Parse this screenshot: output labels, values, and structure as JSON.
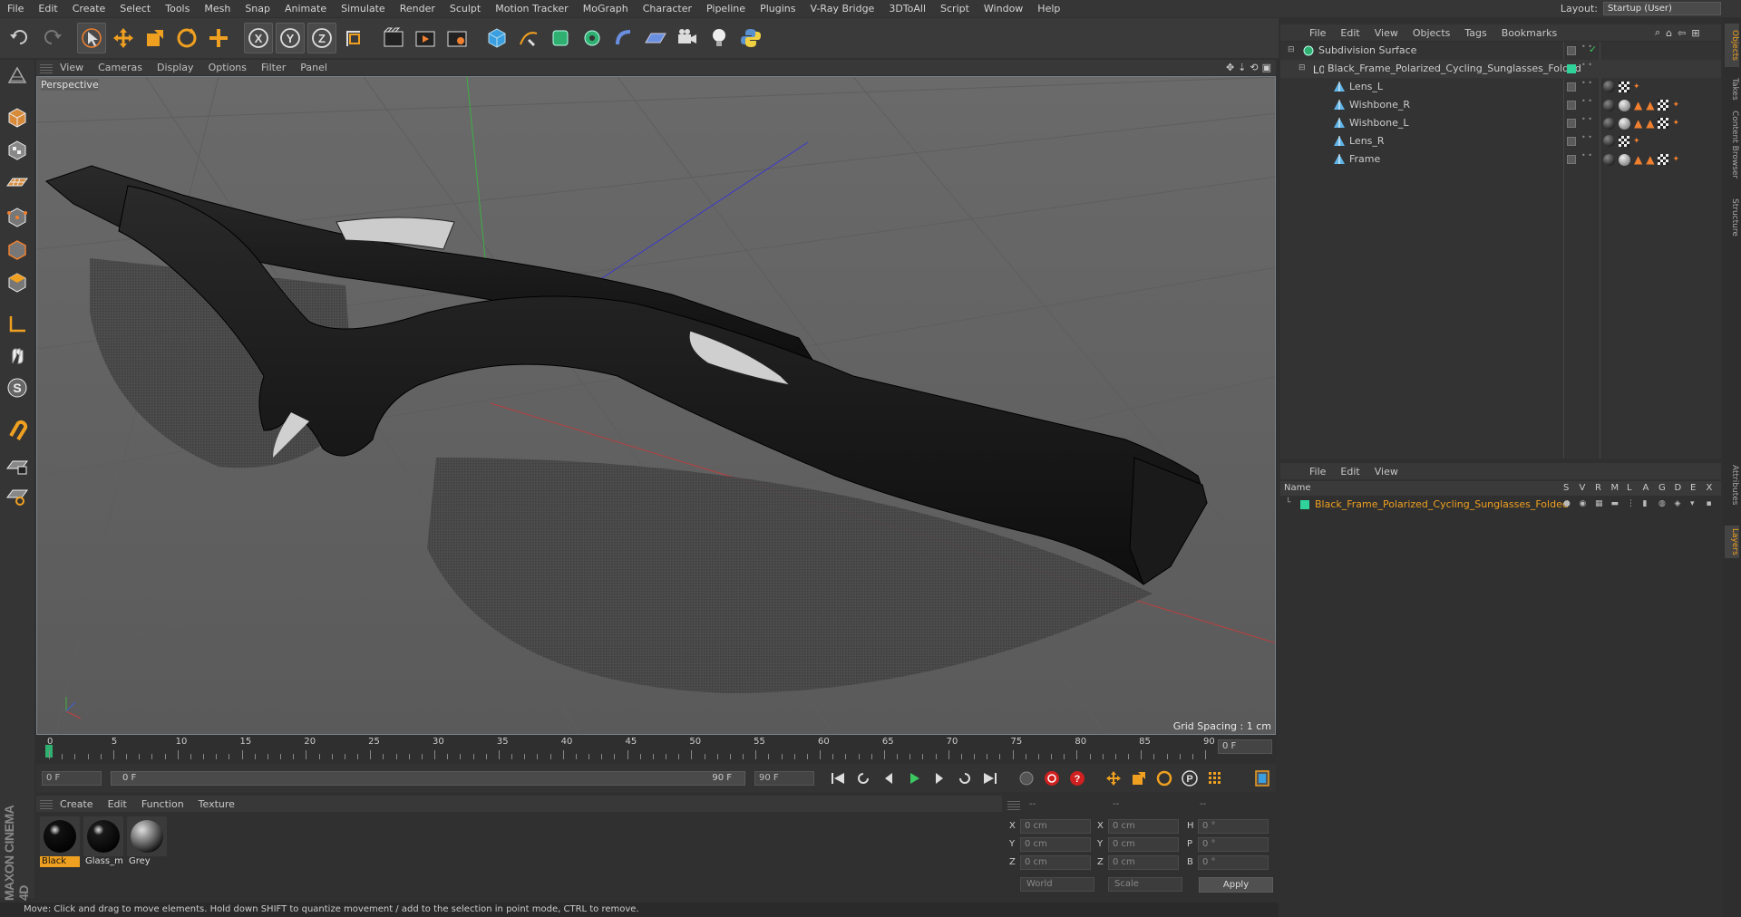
{
  "menubar": {
    "items": [
      "File",
      "Edit",
      "Create",
      "Select",
      "Tools",
      "Mesh",
      "Snap",
      "Animate",
      "Simulate",
      "Render",
      "Sculpt",
      "Motion Tracker",
      "MoGraph",
      "Character",
      "Pipeline",
      "Plugins",
      "V-Ray Bridge",
      "3DToAll",
      "Script",
      "Window",
      "Help"
    ],
    "layout_label": "Layout:",
    "layout_value": "Startup (User)"
  },
  "toolbar": {
    "icons": [
      "undo-icon",
      "redo-icon",
      "select-arrow-icon",
      "move-icon",
      "scale-icon",
      "rotate-icon",
      "add-icon",
      "x-axis-icon",
      "y-axis-icon",
      "z-axis-icon",
      "coordinate-system-icon",
      "render-view-icon",
      "render-picture-viewer-icon",
      "render-settings-icon",
      "cube-primitive-icon",
      "pen-spline-icon",
      "subdivision-icon",
      "array-icon",
      "deformer-icon",
      "floor-icon",
      "camera-icon",
      "light-icon",
      "python-icon"
    ]
  },
  "viewport": {
    "menu": [
      "View",
      "Cameras",
      "Display",
      "Options",
      "Filter",
      "Panel"
    ],
    "camera_label": "Perspective",
    "grid_spacing": "Grid Spacing : 1 cm"
  },
  "timeline": {
    "ticks": [
      "0",
      "5",
      "10",
      "15",
      "20",
      "25",
      "30",
      "35",
      "40",
      "45",
      "50",
      "55",
      "60",
      "65",
      "70",
      "75",
      "80",
      "85",
      "90"
    ],
    "current_frame": "0 F"
  },
  "controls": {
    "start_frame": "0 F",
    "range_start": "0 F",
    "range_end": "90 F",
    "end_frame": "90 F"
  },
  "material_manager": {
    "menu": [
      "Create",
      "Edit",
      "Function",
      "Texture"
    ],
    "materials": [
      {
        "name": "Black",
        "selected": true,
        "color": "#111111"
      },
      {
        "name": "Glass_m",
        "selected": false,
        "color": "#1a1a1a"
      },
      {
        "name": "Grey",
        "selected": false,
        "color": "#b0b0b0"
      }
    ]
  },
  "coordinates": {
    "header": [
      "--",
      "--",
      "--"
    ],
    "pos_labels": [
      "X",
      "Y",
      "Z"
    ],
    "pos_values": [
      "0 cm",
      "0 cm",
      "0 cm"
    ],
    "size_labels": [
      "X",
      "Y",
      "Z"
    ],
    "size_values": [
      "0 cm",
      "0 cm",
      "0 cm"
    ],
    "rot_labels": [
      "H",
      "P",
      "B"
    ],
    "rot_values": [
      "0 °",
      "0 °",
      "0 °"
    ],
    "mode_1": "World",
    "mode_2": "Scale",
    "apply_label": "Apply"
  },
  "status_bar": {
    "text": "Move: Click and drag to move elements. Hold down SHIFT to quantize movement / add to the selection in point mode, CTRL to remove."
  },
  "object_manager": {
    "menu": [
      "File",
      "Edit",
      "View",
      "Objects",
      "Tags",
      "Bookmarks"
    ],
    "objects": [
      {
        "name": "Subdivision Surface",
        "level": 0
      },
      {
        "name": "Black_Frame_Polarized_Cycling_Sunglasses_Folded",
        "level": 1
      },
      {
        "name": "Lens_L",
        "level": 2
      },
      {
        "name": "Wishbone_R",
        "level": 2
      },
      {
        "name": "Wishbone_L",
        "level": 2
      },
      {
        "name": "Lens_R",
        "level": 2
      },
      {
        "name": "Frame",
        "level": 2
      }
    ]
  },
  "layer_manager": {
    "menu": [
      "File",
      "Edit",
      "View"
    ],
    "columns": [
      "Name",
      "S",
      "V",
      "R",
      "M",
      "L",
      "A",
      "G",
      "D",
      "E",
      "X"
    ],
    "layers": [
      {
        "name": "Black_Frame_Polarized_Cycling_Sunglasses_Folded",
        "color": "#2fd39a"
      }
    ]
  },
  "right_tabs": [
    "Objects",
    "Takes",
    "Content Browser",
    "Structure",
    "Attributes",
    "Layers"
  ],
  "branding": {
    "logo_text": "MAXON CINEMA 4D"
  },
  "colors": {
    "accent": "#f0a020",
    "layer_green": "#2fd39a",
    "selection_orange": "#f08030"
  }
}
